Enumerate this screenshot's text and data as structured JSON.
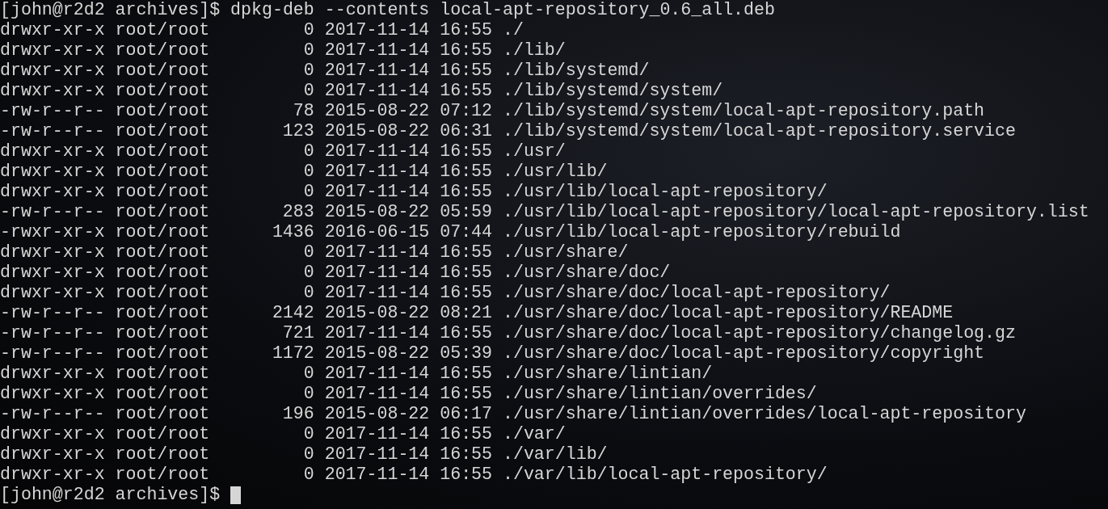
{
  "terminal": {
    "command_line": {
      "prompt": "[john@r2d2 archives]$",
      "command": "dpkg-deb --contents local-apt-repository_0.6_all.deb"
    },
    "entries": [
      {
        "mode": "drwxr-xr-x",
        "owner": "root/root",
        "size": "0",
        "date": "2017-11-14",
        "time": "16:55",
        "path": "./"
      },
      {
        "mode": "drwxr-xr-x",
        "owner": "root/root",
        "size": "0",
        "date": "2017-11-14",
        "time": "16:55",
        "path": "./lib/"
      },
      {
        "mode": "drwxr-xr-x",
        "owner": "root/root",
        "size": "0",
        "date": "2017-11-14",
        "time": "16:55",
        "path": "./lib/systemd/"
      },
      {
        "mode": "drwxr-xr-x",
        "owner": "root/root",
        "size": "0",
        "date": "2017-11-14",
        "time": "16:55",
        "path": "./lib/systemd/system/"
      },
      {
        "mode": "-rw-r--r--",
        "owner": "root/root",
        "size": "78",
        "date": "2015-08-22",
        "time": "07:12",
        "path": "./lib/systemd/system/local-apt-repository.path"
      },
      {
        "mode": "-rw-r--r--",
        "owner": "root/root",
        "size": "123",
        "date": "2015-08-22",
        "time": "06:31",
        "path": "./lib/systemd/system/local-apt-repository.service"
      },
      {
        "mode": "drwxr-xr-x",
        "owner": "root/root",
        "size": "0",
        "date": "2017-11-14",
        "time": "16:55",
        "path": "./usr/"
      },
      {
        "mode": "drwxr-xr-x",
        "owner": "root/root",
        "size": "0",
        "date": "2017-11-14",
        "time": "16:55",
        "path": "./usr/lib/"
      },
      {
        "mode": "drwxr-xr-x",
        "owner": "root/root",
        "size": "0",
        "date": "2017-11-14",
        "time": "16:55",
        "path": "./usr/lib/local-apt-repository/"
      },
      {
        "mode": "-rw-r--r--",
        "owner": "root/root",
        "size": "283",
        "date": "2015-08-22",
        "time": "05:59",
        "path": "./usr/lib/local-apt-repository/local-apt-repository.list"
      },
      {
        "mode": "-rwxr-xr-x",
        "owner": "root/root",
        "size": "1436",
        "date": "2016-06-15",
        "time": "07:44",
        "path": "./usr/lib/local-apt-repository/rebuild"
      },
      {
        "mode": "drwxr-xr-x",
        "owner": "root/root",
        "size": "0",
        "date": "2017-11-14",
        "time": "16:55",
        "path": "./usr/share/"
      },
      {
        "mode": "drwxr-xr-x",
        "owner": "root/root",
        "size": "0",
        "date": "2017-11-14",
        "time": "16:55",
        "path": "./usr/share/doc/"
      },
      {
        "mode": "drwxr-xr-x",
        "owner": "root/root",
        "size": "0",
        "date": "2017-11-14",
        "time": "16:55",
        "path": "./usr/share/doc/local-apt-repository/"
      },
      {
        "mode": "-rw-r--r--",
        "owner": "root/root",
        "size": "2142",
        "date": "2015-08-22",
        "time": "08:21",
        "path": "./usr/share/doc/local-apt-repository/README"
      },
      {
        "mode": "-rw-r--r--",
        "owner": "root/root",
        "size": "721",
        "date": "2017-11-14",
        "time": "16:55",
        "path": "./usr/share/doc/local-apt-repository/changelog.gz"
      },
      {
        "mode": "-rw-r--r--",
        "owner": "root/root",
        "size": "1172",
        "date": "2015-08-22",
        "time": "05:39",
        "path": "./usr/share/doc/local-apt-repository/copyright"
      },
      {
        "mode": "drwxr-xr-x",
        "owner": "root/root",
        "size": "0",
        "date": "2017-11-14",
        "time": "16:55",
        "path": "./usr/share/lintian/"
      },
      {
        "mode": "drwxr-xr-x",
        "owner": "root/root",
        "size": "0",
        "date": "2017-11-14",
        "time": "16:55",
        "path": "./usr/share/lintian/overrides/"
      },
      {
        "mode": "-rw-r--r--",
        "owner": "root/root",
        "size": "196",
        "date": "2015-08-22",
        "time": "06:17",
        "path": "./usr/share/lintian/overrides/local-apt-repository"
      },
      {
        "mode": "drwxr-xr-x",
        "owner": "root/root",
        "size": "0",
        "date": "2017-11-14",
        "time": "16:55",
        "path": "./var/"
      },
      {
        "mode": "drwxr-xr-x",
        "owner": "root/root",
        "size": "0",
        "date": "2017-11-14",
        "time": "16:55",
        "path": "./var/lib/"
      },
      {
        "mode": "drwxr-xr-x",
        "owner": "root/root",
        "size": "0",
        "date": "2017-11-14",
        "time": "16:55",
        "path": "./var/lib/local-apt-repository/"
      }
    ],
    "final_prompt": "[john@r2d2 archives]$"
  }
}
